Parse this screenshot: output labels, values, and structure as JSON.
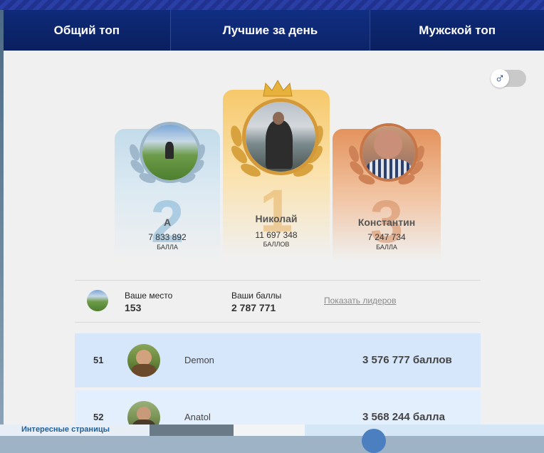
{
  "tabs": [
    {
      "label": "Общий топ"
    },
    {
      "label": "Лучшие за день"
    },
    {
      "label": "Мужской топ"
    }
  ],
  "toggle": {
    "icon": "male-symbol-icon",
    "symbol": "♂"
  },
  "podium": {
    "first": {
      "rank": "1",
      "name": "Николай",
      "score": "11 697 348",
      "unit": "БАЛЛОВ"
    },
    "second": {
      "rank": "2",
      "name": "А",
      "score": "7 833 892",
      "unit": "БАЛЛА"
    },
    "third": {
      "rank": "3",
      "name": "Константин",
      "score": "7 247 734",
      "unit": "БАЛЛА"
    }
  },
  "you": {
    "place_label": "Ваше место",
    "place_value": "153",
    "points_label": "Ваши баллы",
    "points_value": "2 787 771",
    "show_leaders": "Показать лидеров"
  },
  "list": [
    {
      "rank": "51",
      "name": "Demon",
      "score": "3 576 777 баллов"
    },
    {
      "rank": "52",
      "name": "Anatol",
      "score": "3 568 244 балла"
    }
  ],
  "background": {
    "link_text": "Интересные страницы"
  },
  "colors": {
    "tab_bg": "#0e2a79",
    "gold": "#f6c86a",
    "silver": "#c3dcea",
    "bronze": "#e3935d",
    "row_highlight": "#d6e7fb"
  }
}
